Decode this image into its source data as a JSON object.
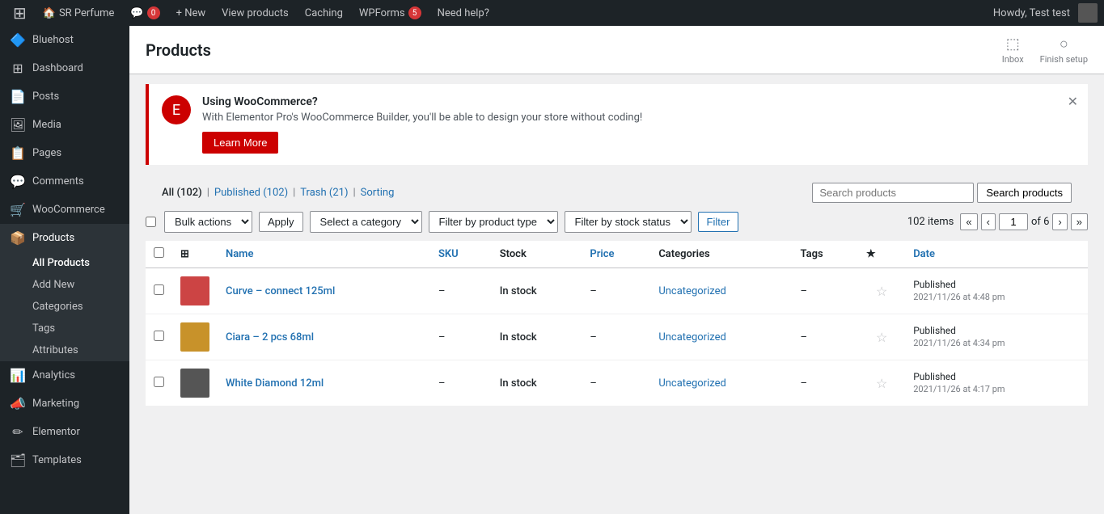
{
  "adminBar": {
    "wpLogo": "⊞",
    "siteName": "SR Perfume",
    "homeIcon": "🏠",
    "commentsBadge": "0",
    "newLabel": "+ New",
    "viewProducts": "View products",
    "caching": "Caching",
    "wpForms": "WPForms",
    "wpFormsBadge": "5",
    "needHelp": "Need help?",
    "howdy": "Howdy, Test test"
  },
  "sidebar": {
    "items": [
      {
        "id": "bluehost",
        "label": "Bluehost",
        "icon": "🔷"
      },
      {
        "id": "dashboard",
        "label": "Dashboard",
        "icon": "⊞"
      },
      {
        "id": "posts",
        "label": "Posts",
        "icon": "📄"
      },
      {
        "id": "media",
        "label": "Media",
        "icon": "🖼"
      },
      {
        "id": "pages",
        "label": "Pages",
        "icon": "📋"
      },
      {
        "id": "comments",
        "label": "Comments",
        "icon": "💬"
      },
      {
        "id": "woocommerce",
        "label": "WooCommerce",
        "icon": "🛒"
      },
      {
        "id": "products",
        "label": "Products",
        "icon": "📦",
        "active": true
      },
      {
        "id": "analytics",
        "label": "Analytics",
        "icon": "📊"
      },
      {
        "id": "marketing",
        "label": "Marketing",
        "icon": "📣"
      },
      {
        "id": "elementor",
        "label": "Elementor",
        "icon": "✏"
      },
      {
        "id": "templates",
        "label": "Templates",
        "icon": "🗂"
      }
    ],
    "subItems": [
      {
        "id": "all-products",
        "label": "All Products",
        "active": true
      },
      {
        "id": "add-new",
        "label": "Add New"
      },
      {
        "id": "categories",
        "label": "Categories"
      },
      {
        "id": "tags",
        "label": "Tags"
      },
      {
        "id": "attributes",
        "label": "Attributes"
      }
    ]
  },
  "pageHeader": {
    "title": "Products",
    "inboxLabel": "Inbox",
    "finishSetupLabel": "Finish setup"
  },
  "promo": {
    "icon": "E",
    "title": "Using WooCommerce?",
    "text": "With Elementor Pro's WooCommerce Builder, you'll be able to design your store without coding!",
    "buttonLabel": "Learn More"
  },
  "filterTabs": [
    {
      "id": "all",
      "label": "All (102)",
      "active": true
    },
    {
      "id": "published",
      "label": "Published (102)"
    },
    {
      "id": "trash",
      "label": "Trash (21)"
    },
    {
      "id": "sorting",
      "label": "Sorting"
    }
  ],
  "actionBar": {
    "bulkActions": "Bulk actions",
    "applyLabel": "Apply",
    "selectCategory": "Select a category",
    "filterByProductType": "Filter by product type",
    "filterByStockStatus": "Filter by stock status",
    "filterLabel": "Filter",
    "itemsCount": "102 items",
    "pageNum": "1",
    "pageOf": "of 6"
  },
  "searchBar": {
    "placeholder": "Search products",
    "buttonLabel": "Search products"
  },
  "tableHeaders": [
    {
      "id": "name",
      "label": "Name"
    },
    {
      "id": "sku",
      "label": "SKU"
    },
    {
      "id": "stock",
      "label": "Stock"
    },
    {
      "id": "price",
      "label": "Price"
    },
    {
      "id": "categories",
      "label": "Categories"
    },
    {
      "id": "tags",
      "label": "Tags"
    },
    {
      "id": "featured",
      "label": "★"
    },
    {
      "id": "date",
      "label": "Date"
    }
  ],
  "products": [
    {
      "id": 1,
      "name": "Curve – connect 125ml",
      "sku": "–",
      "stock": "In stock",
      "price": "–",
      "categories": "Uncategorized",
      "tags": "–",
      "featured": false,
      "status": "Published",
      "date": "2021/11/26 at 4:48 pm",
      "thumbColor": "#c44"
    },
    {
      "id": 2,
      "name": "Ciara – 2 pcs 68ml",
      "sku": "–",
      "stock": "In stock",
      "price": "–",
      "categories": "Uncategorized",
      "tags": "–",
      "featured": false,
      "status": "Published",
      "date": "2021/11/26 at 4:34 pm",
      "thumbColor": "#c8922a"
    },
    {
      "id": 3,
      "name": "White Diamond 12ml",
      "sku": "–",
      "stock": "In stock",
      "price": "–",
      "categories": "Uncategorized",
      "tags": "–",
      "featured": false,
      "status": "Published",
      "date": "2021/11/26 at 4:17 pm",
      "thumbColor": "#555"
    }
  ]
}
